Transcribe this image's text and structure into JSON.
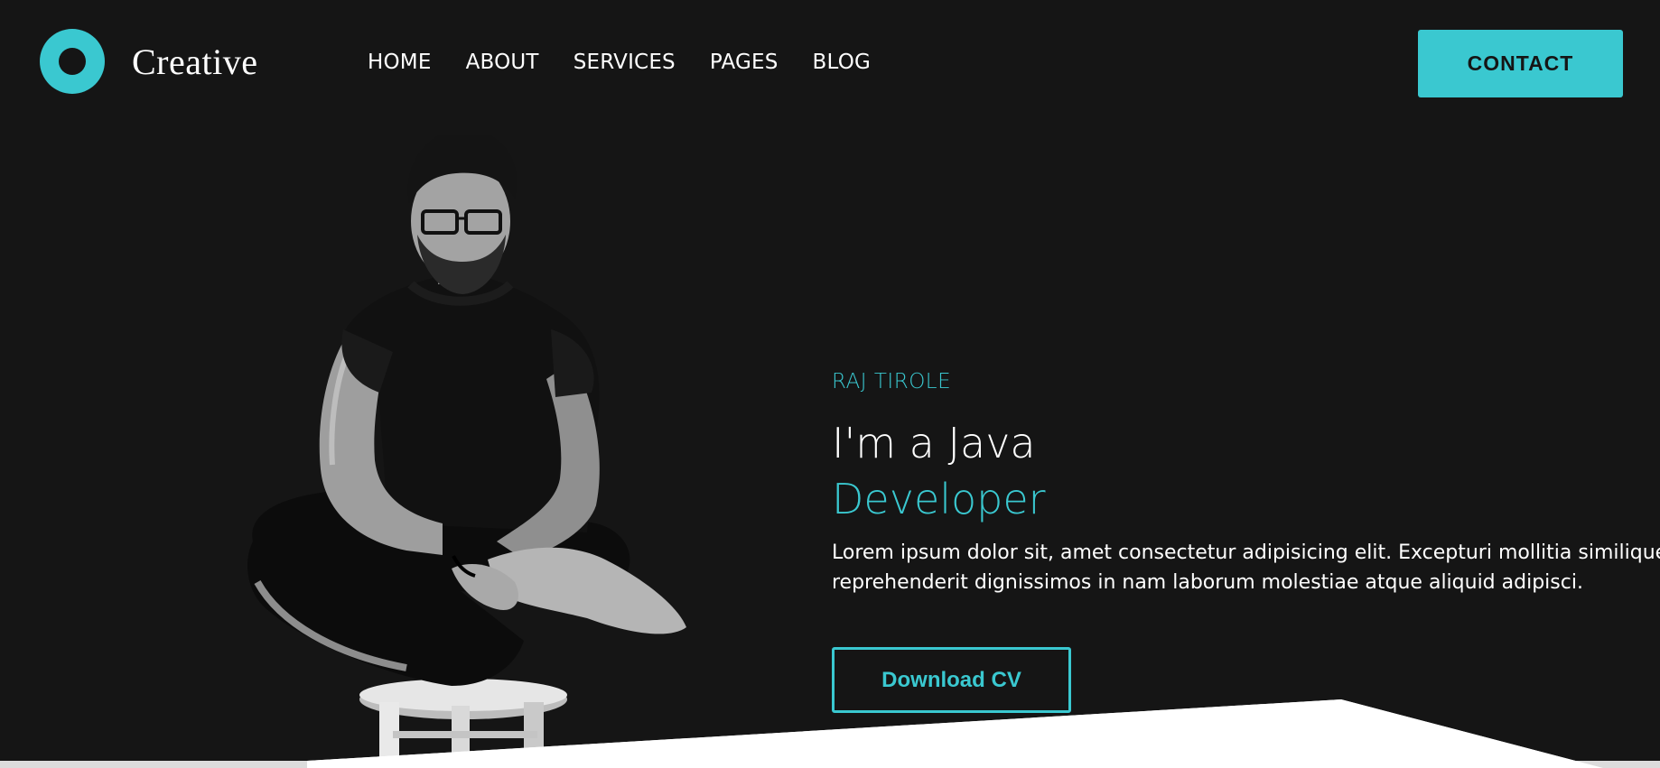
{
  "brand": {
    "name": "Creative",
    "accent_color": "#3ac8d0",
    "background_color": "#151515"
  },
  "nav": {
    "items": [
      "HOME",
      "ABOUT",
      "SERVICES",
      "PAGES",
      "BLOG"
    ]
  },
  "header": {
    "contact_label": "CONTACT"
  },
  "hero": {
    "name": "RAJ TIROLE",
    "title": "I'm a Java",
    "role": "Developer",
    "description_line1": "Lorem ipsum dolor sit, amet consectetur adipisicing elit. Excepturi mollitia similique",
    "description_line2": "reprehenderit dignissimos in nam laborum molestiae atque aliquid adipisci.",
    "download_label": "Download CV",
    "portrait_icon": "person-portrait"
  }
}
